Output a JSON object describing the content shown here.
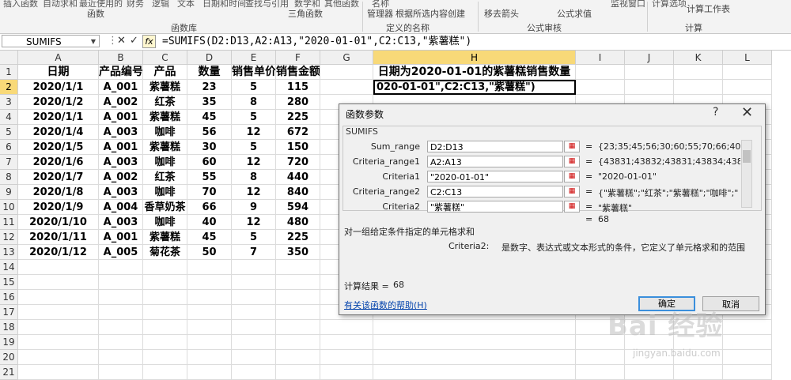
{
  "ribbon": {
    "top_items": [
      "插入函数",
      "自动求和",
      "最近使用的",
      "财务",
      "逻辑",
      "文本",
      "日期和时间",
      "查找与引用",
      "数学和",
      "其他函数",
      "名称",
      "根据所选内容创建",
      "公式求值",
      "监视窗口",
      "计算选项",
      "计算工作表"
    ],
    "sub_items": [
      "函数",
      "三角函数",
      "管理器",
      "移去箭头"
    ],
    "sections": [
      "函数库",
      "定义的名称",
      "公式审核",
      "计算"
    ]
  },
  "formula_bar": {
    "name_box": "SUMIFS",
    "fx": "fx",
    "formula": "=SUMIFS(D2:D13,A2:A13,\"2020-01-01\",C2:C13,\"紫薯糕\")"
  },
  "grid": {
    "columns": [
      "A",
      "B",
      "C",
      "D",
      "E",
      "F",
      "G",
      "H",
      "I",
      "J",
      "K",
      "L"
    ],
    "rows": [
      "1",
      "2",
      "3",
      "4",
      "5",
      "6",
      "7",
      "8",
      "9",
      "10",
      "11",
      "12",
      "13",
      "14",
      "15",
      "16",
      "17",
      "18",
      "19",
      "20",
      "21"
    ],
    "headers": [
      "日期",
      "产品编号",
      "产品",
      "数量",
      "销售单价",
      "销售金额"
    ],
    "data": [
      [
        "2020/1/1",
        "A_001",
        "紫薯糕",
        "23",
        "5",
        "115"
      ],
      [
        "2020/1/2",
        "A_002",
        "红茶",
        "35",
        "8",
        "280"
      ],
      [
        "2020/1/1",
        "A_001",
        "紫薯糕",
        "45",
        "5",
        "225"
      ],
      [
        "2020/1/4",
        "A_003",
        "咖啡",
        "56",
        "12",
        "672"
      ],
      [
        "2020/1/5",
        "A_001",
        "紫薯糕",
        "30",
        "5",
        "150"
      ],
      [
        "2020/1/6",
        "A_003",
        "咖啡",
        "60",
        "12",
        "720"
      ],
      [
        "2020/1/7",
        "A_002",
        "红茶",
        "55",
        "8",
        "440"
      ],
      [
        "2020/1/8",
        "A_003",
        "咖啡",
        "70",
        "12",
        "840"
      ],
      [
        "2020/1/9",
        "A_004",
        "香草奶茶",
        "66",
        "9",
        "594"
      ],
      [
        "2020/1/10",
        "A_003",
        "咖啡",
        "40",
        "12",
        "480"
      ],
      [
        "2020/1/11",
        "A_001",
        "紫薯糕",
        "45",
        "5",
        "225"
      ],
      [
        "2020/1/12",
        "A_005",
        "菊花茶",
        "50",
        "7",
        "350"
      ]
    ],
    "h1": "日期为2020-01-01的紫薯糕销售数量",
    "h2": "020-01-01\",C2:C13,\"紫薯糕\")"
  },
  "dialog": {
    "title": "函数参数",
    "help_q": "?",
    "close": "✕",
    "function_name": "SUMIFS",
    "args": [
      {
        "label": "Sum_range",
        "input": "D2:D13",
        "value": "{23;35;45;56;30;60;55;70;66;40..."
      },
      {
        "label": "Criteria_range1",
        "input": "A2:A13",
        "value": "{43831;43832;43831;43834;43835..."
      },
      {
        "label": "Criteria1",
        "input": "\"2020-01-01\"",
        "value": "\"2020-01-01\""
      },
      {
        "label": "Criteria_range2",
        "input": "C2:C13",
        "value": "{\"紫薯糕\";\"红茶\";\"紫薯糕\";\"咖啡\";\""
      },
      {
        "label": "Criteria2",
        "input": "\"紫薯糕\"",
        "value": "\"紫薯糕\""
      }
    ],
    "equals": "=",
    "result_inline": "68",
    "description": "对一组给定条件指定的单元格求和",
    "arg_desc_name": "Criteria2:",
    "arg_desc": "是数字、表达式或文本形式的条件，它定义了单元格求和的范围",
    "calc_result_label": "计算结果 =",
    "calc_result": "68",
    "help_link": "有关该函数的帮助(H)",
    "ok": "确定",
    "cancel": "取消"
  },
  "watermark": {
    "logo": "Bai 经验",
    "url": "jingyan.baidu.com"
  },
  "colors": {
    "selected_header": "#f8d978",
    "dialog_bg": "#f0f0f0",
    "link": "#0645ad"
  }
}
